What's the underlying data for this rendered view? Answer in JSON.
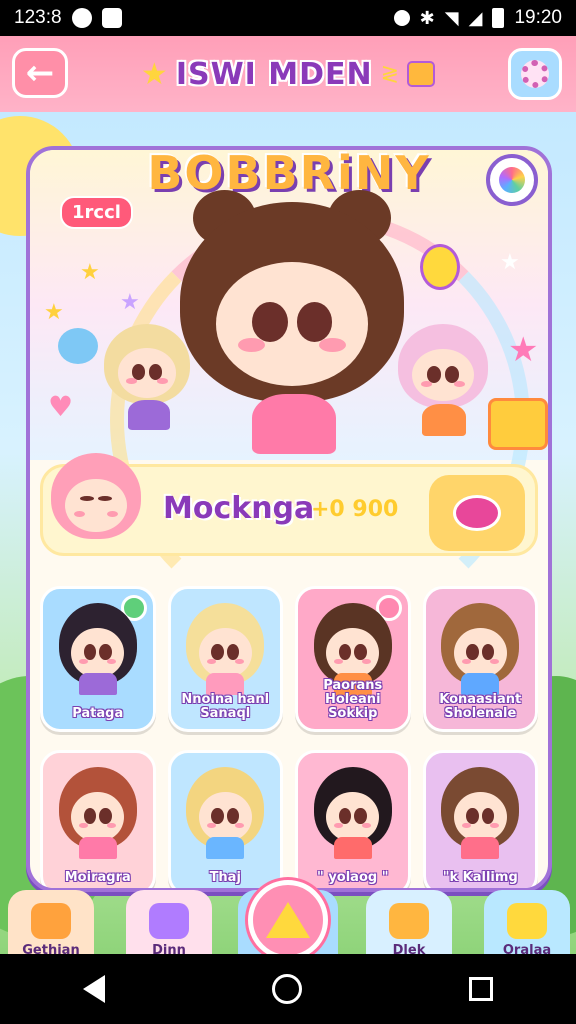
{
  "status_bar": {
    "time_left": "123:8",
    "time_right": "19:20"
  },
  "header": {
    "title": "ISWI MDEN"
  },
  "hero": {
    "logo": "BOBBRiNY",
    "level_badge": "1rccl"
  },
  "profile": {
    "name": "Mocknga",
    "coins": "+0 900"
  },
  "characters": [
    {
      "label": "Pataga"
    },
    {
      "label": "Nnoina hanl Sanaql"
    },
    {
      "label": "Paorans Holeani Sokkip"
    },
    {
      "label": "Konaasiant Sholenale"
    },
    {
      "label": "Moiragra"
    },
    {
      "label": "Thaj"
    },
    {
      "label": "\" yolaog \""
    },
    {
      "label": "\"k Kallimg"
    }
  ],
  "bottom_nav": [
    {
      "label": "Gethian"
    },
    {
      "label": "Dinn"
    },
    {
      "label": ""
    },
    {
      "label": "Dlek"
    },
    {
      "label": "Oralaa"
    }
  ],
  "colors": {
    "accent": "#8a3ab9",
    "header": "#ffb3c8",
    "card_border": "#a072d8"
  },
  "icons": {
    "back": "arrow-left-icon",
    "settings": "gear-icon",
    "chat": "chat-bubble-icon",
    "play": "triangle-play-icon"
  }
}
